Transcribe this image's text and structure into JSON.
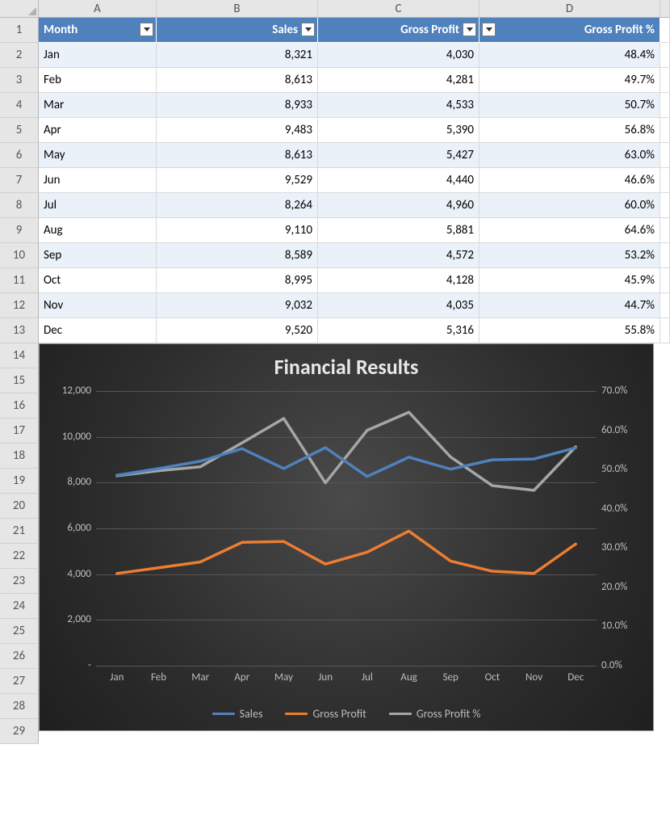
{
  "columns": [
    "A",
    "B",
    "C",
    "D"
  ],
  "headers": {
    "a": "Month",
    "b": "Sales",
    "c": "Gross Profit",
    "d": "Gross Profit %"
  },
  "rows": [
    {
      "m": "Jan",
      "s": "8,321",
      "g": "4,030",
      "p": "48.4%"
    },
    {
      "m": "Feb",
      "s": "8,613",
      "g": "4,281",
      "p": "49.7%"
    },
    {
      "m": "Mar",
      "s": "8,933",
      "g": "4,533",
      "p": "50.7%"
    },
    {
      "m": "Apr",
      "s": "9,483",
      "g": "5,390",
      "p": "56.8%"
    },
    {
      "m": "May",
      "s": "8,613",
      "g": "5,427",
      "p": "63.0%"
    },
    {
      "m": "Jun",
      "s": "9,529",
      "g": "4,440",
      "p": "46.6%"
    },
    {
      "m": "Jul",
      "s": "8,264",
      "g": "4,960",
      "p": "60.0%"
    },
    {
      "m": "Aug",
      "s": "9,110",
      "g": "5,881",
      "p": "64.6%"
    },
    {
      "m": "Sep",
      "s": "8,589",
      "g": "4,572",
      "p": "53.2%"
    },
    {
      "m": "Oct",
      "s": "8,995",
      "g": "4,128",
      "p": "45.9%"
    },
    {
      "m": "Nov",
      "s": "9,032",
      "g": "4,035",
      "p": "44.7%"
    },
    {
      "m": "Dec",
      "s": "9,520",
      "g": "5,316",
      "p": "55.8%"
    }
  ],
  "chart_title": "Financial Results",
  "legend": {
    "sales": "Sales",
    "gross": "Gross Profit",
    "pct": "Gross Profit %"
  },
  "colors": {
    "sales": "#4f81bd",
    "gross": "#ed7d31",
    "pct": "#a6a6a6"
  },
  "y_left_ticks": [
    "12,000",
    "10,000",
    "8,000",
    "6,000",
    "4,000",
    "2,000",
    "-"
  ],
  "y_right_ticks": [
    "70.0%",
    "60.0%",
    "50.0%",
    "40.0%",
    "30.0%",
    "20.0%",
    "10.0%",
    "0.0%"
  ],
  "chart_data": {
    "type": "line",
    "categories": [
      "Jan",
      "Feb",
      "Mar",
      "Apr",
      "May",
      "Jun",
      "Jul",
      "Aug",
      "Sep",
      "Oct",
      "Nov",
      "Dec"
    ],
    "series": [
      {
        "name": "Sales",
        "axis": "left",
        "values": [
          8321,
          8613,
          8933,
          9483,
          8613,
          9529,
          8264,
          9110,
          8589,
          8995,
          9032,
          9520
        ]
      },
      {
        "name": "Gross Profit",
        "axis": "left",
        "values": [
          4030,
          4281,
          4533,
          5390,
          5427,
          4440,
          4960,
          5881,
          4572,
          4128,
          4035,
          5316
        ]
      },
      {
        "name": "Gross Profit %",
        "axis": "right",
        "values": [
          48.4,
          49.7,
          50.7,
          56.8,
          63.0,
          46.6,
          60.0,
          64.6,
          53.2,
          45.9,
          44.7,
          55.8
        ]
      }
    ],
    "y_left": {
      "min": 0,
      "max": 12000,
      "step": 2000
    },
    "y_right": {
      "min": 0,
      "max": 70,
      "step": 10,
      "unit": "%"
    },
    "title": "Financial Results"
  }
}
